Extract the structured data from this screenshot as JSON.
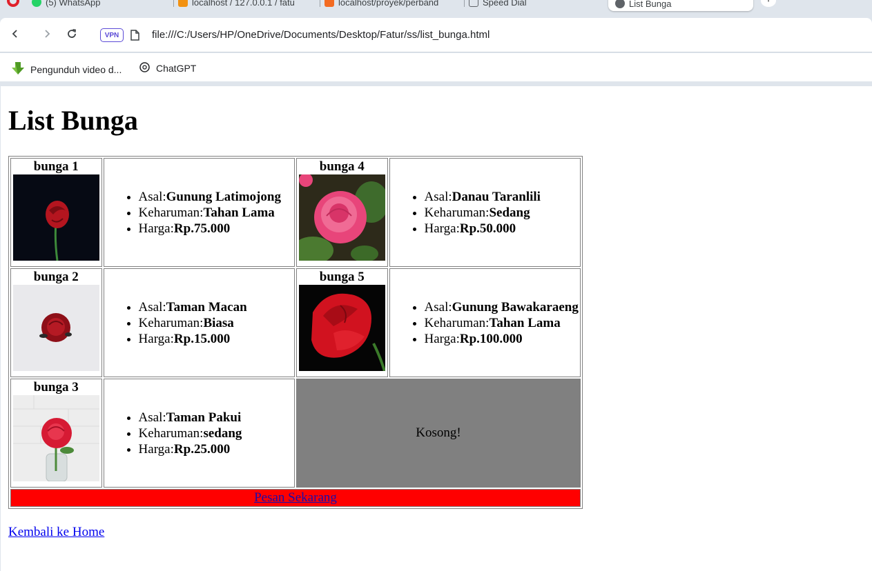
{
  "browser": {
    "tabs": [
      {
        "label": "(5) WhatsApp"
      },
      {
        "label": "localhost / 127.0.0.1 / fatu"
      },
      {
        "label": "localhost/proyek/perband"
      },
      {
        "label": "Speed Dial"
      },
      {
        "label": "List Bunga"
      }
    ],
    "new_tab_symbol": "+",
    "vpn_label": "VPN",
    "url": "file:///C:/Users/HP/OneDrive/Documents/Desktop/Fatur/ss/list_bunga.html",
    "bookmarks": [
      {
        "label": "Pengunduh video d...",
        "icon": "download-arrow-icon"
      },
      {
        "label": "ChatGPT",
        "icon": "chatgpt-icon"
      }
    ]
  },
  "page": {
    "title": "List Bunga",
    "labels": {
      "origin": "Asal:",
      "fragrance": "Keharuman:",
      "price": "Harga:"
    },
    "flowers": [
      {
        "name": "bunga 1",
        "origin": "Gunung Latimojong",
        "fragrance": "Tahan Lama",
        "price": "Rp.75.000"
      },
      {
        "name": "bunga 2",
        "origin": "Taman Macan",
        "fragrance": "Biasa",
        "price": "Rp.15.000"
      },
      {
        "name": "bunga 3",
        "origin": "Taman Pakui",
        "fragrance": "sedang",
        "price": "Rp.25.000"
      },
      {
        "name": "bunga 4",
        "origin": "Danau Taranlili",
        "fragrance": "Sedang",
        "price": "Rp.50.000"
      },
      {
        "name": "bunga 5",
        "origin": "Gunung Bawakaraeng",
        "fragrance": "Tahan Lama",
        "price": "Rp.100.000"
      }
    ],
    "empty_label": "Kosong!",
    "order_label": "Pesan Sekarang",
    "back_label": "Kembali ke Home"
  },
  "colors": {
    "empty_cell": "#808080",
    "order_row": "#ff0000",
    "link": "#0000ee"
  }
}
